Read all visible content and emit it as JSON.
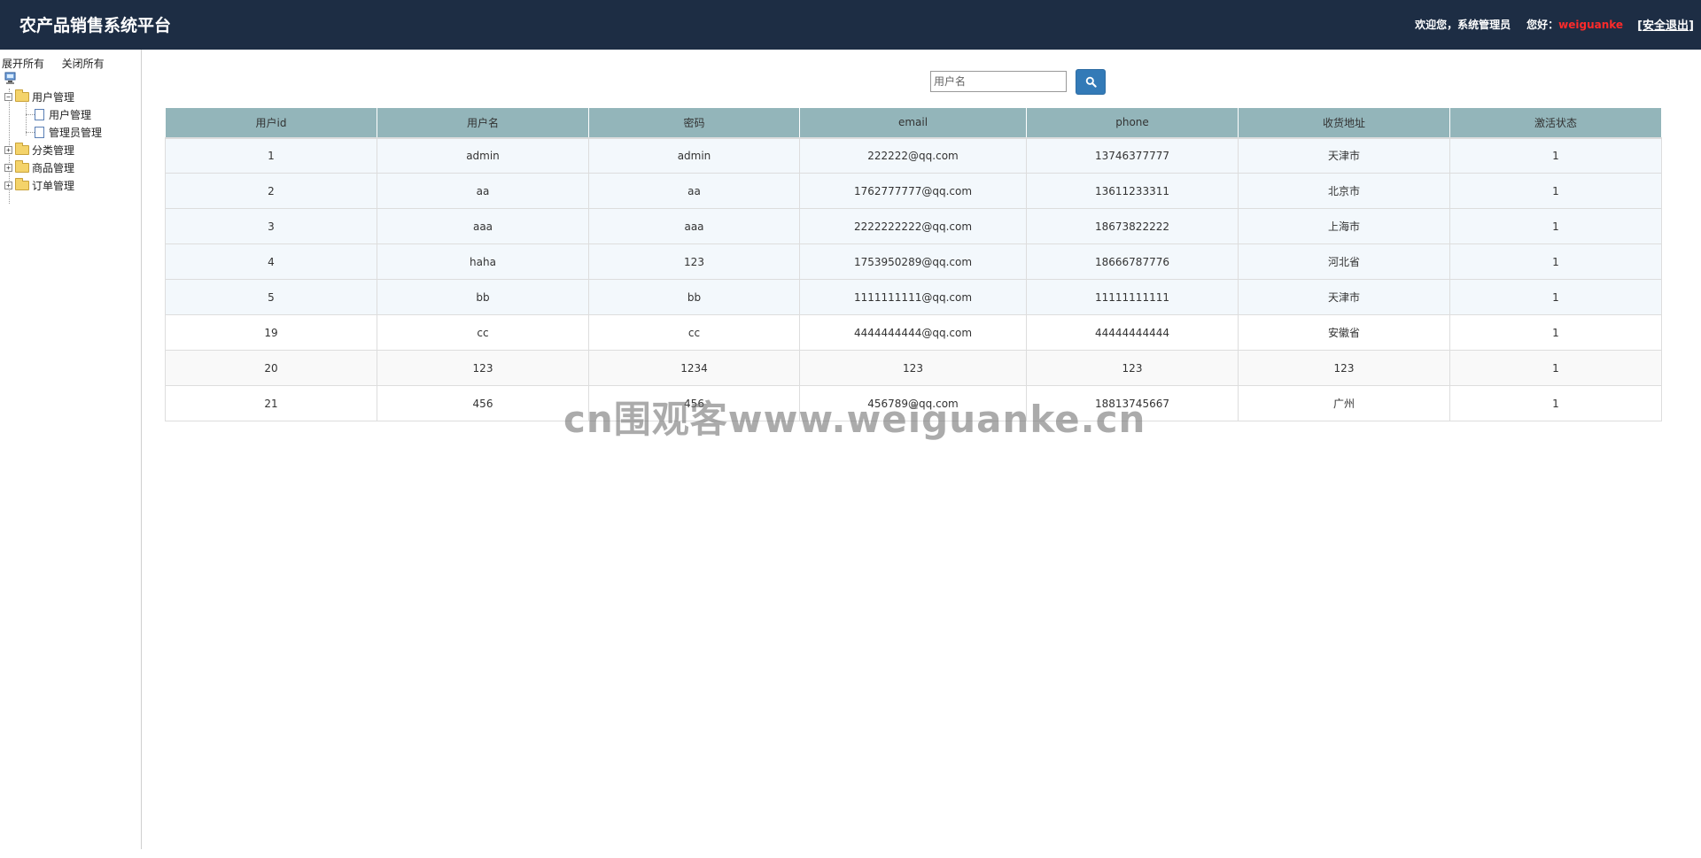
{
  "header": {
    "title": "农产品销售系统平台",
    "welcome": "欢迎您，系统管理员",
    "greeting": "您好：",
    "username": "weiguanke",
    "logout_open": "[",
    "logout_label": "安全退出",
    "logout_close": "]"
  },
  "sidebar": {
    "expand_all": "展开所有",
    "collapse_all": "关闭所有",
    "tree": [
      {
        "label": "用户管理",
        "expander": "−",
        "children": [
          "用户管理",
          "管理员管理"
        ]
      },
      {
        "label": "分类管理",
        "expander": "+"
      },
      {
        "label": "商品管理",
        "expander": "+"
      },
      {
        "label": "订单管理",
        "expander": "+"
      }
    ]
  },
  "search": {
    "placeholder": "用户名",
    "icon": "search-icon"
  },
  "table": {
    "columns": [
      "用户id",
      "用户名",
      "密码",
      "email",
      "phone",
      "收货地址",
      "激活状态"
    ],
    "rows": [
      [
        "1",
        "admin",
        "admin",
        "222222@qq.com",
        "13746377777",
        "天津市",
        "1"
      ],
      [
        "2",
        "aa",
        "aa",
        "1762777777@qq.com",
        "13611233311",
        "北京市",
        "1"
      ],
      [
        "3",
        "aaa",
        "aaa",
        "2222222222@qq.com",
        "18673822222",
        "上海市",
        "1"
      ],
      [
        "4",
        "haha",
        "123",
        "1753950289@qq.com",
        "18666787776",
        "河北省",
        "1"
      ],
      [
        "5",
        "bb",
        "bb",
        "1111111111@qq.com",
        "11111111111",
        "天津市",
        "1"
      ],
      [
        "19",
        "cc",
        "cc",
        "4444444444@qq.com",
        "44444444444",
        "安徽省",
        "1"
      ],
      [
        "20",
        "123",
        "1234",
        "123",
        "123",
        "123",
        "1"
      ],
      [
        "21",
        "456",
        "456",
        "456789@qq.com",
        "18813745667",
        "广州",
        "1"
      ]
    ]
  },
  "watermark": "cn围观客www.weiguanke.cn",
  "colors": {
    "header_bg": "#1d2d44",
    "table_header_bg": "#93b5ba",
    "button_bg": "#337ab7",
    "username": "#ff2a2a"
  }
}
